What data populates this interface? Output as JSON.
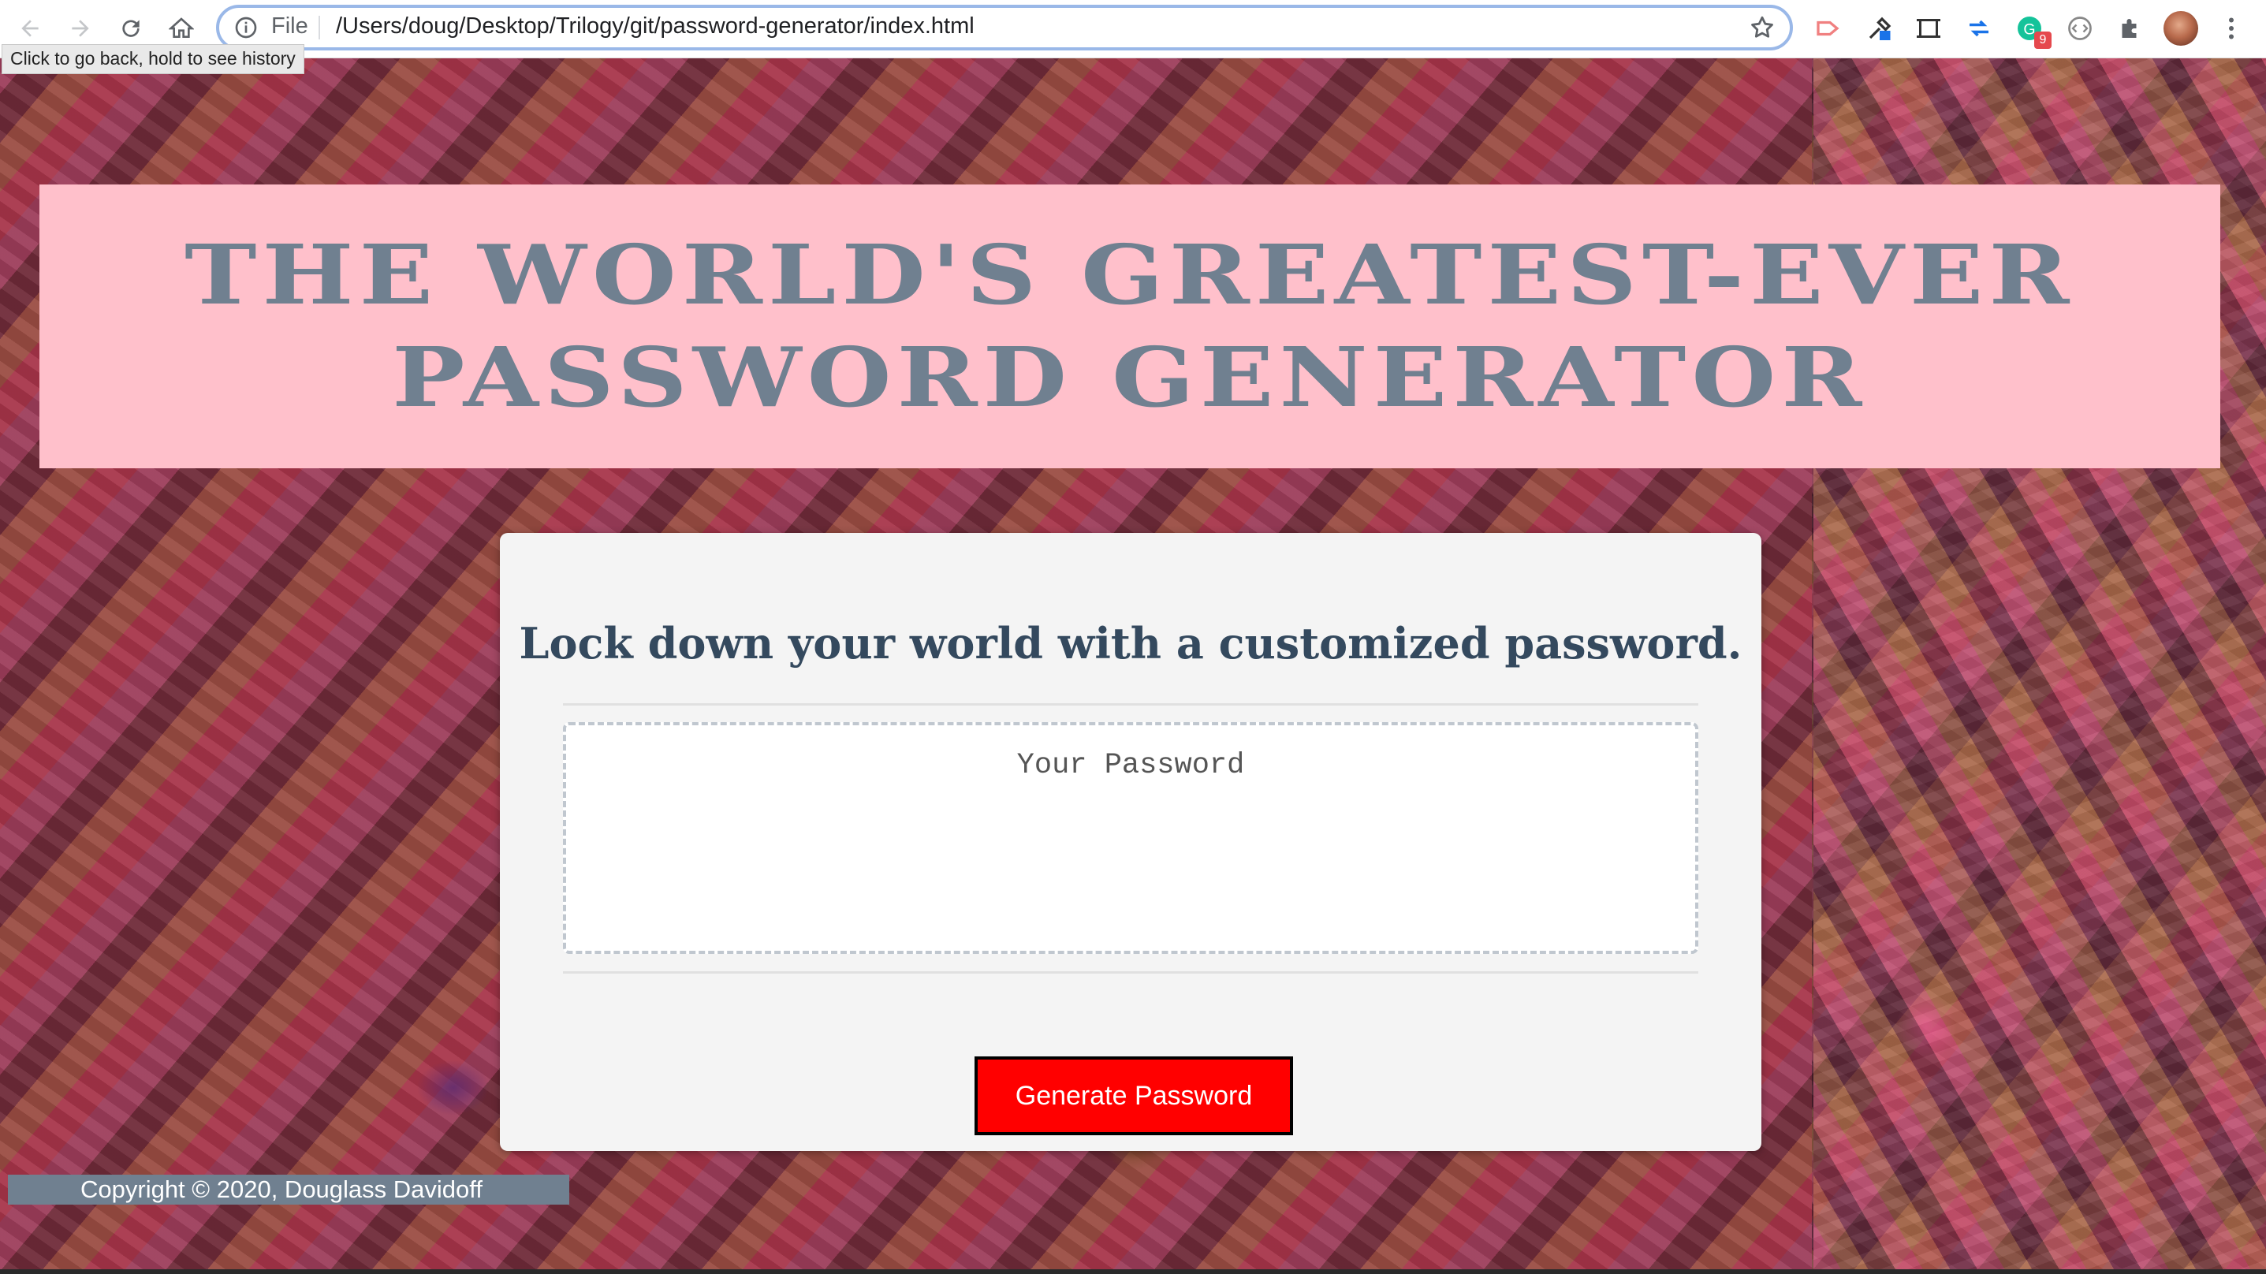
{
  "browser": {
    "omnibox_scheme": "File",
    "url": "/Users/doug/Desktop/Trilogy/git/password-generator/index.html",
    "tooltip": "Click to go back, hold to see history",
    "extension_badge": "9",
    "icons": [
      "back-icon",
      "forward-icon",
      "reload-icon",
      "home-icon",
      "info-icon",
      "star-icon",
      "cast-icon",
      "eyedropper-icon",
      "screenshot-icon",
      "sync-arrows-icon",
      "grammarly-icon",
      "code-icon",
      "puzzle-icon",
      "avatar",
      "kebab-menu-icon"
    ]
  },
  "page": {
    "header": {
      "title_line1": "THE WORLD'S GREATEST-EVER",
      "title_line2": "PASSWORD GENERATOR"
    },
    "card": {
      "heading": "Lock down your world with a customized password.",
      "password_placeholder": "Your Password",
      "password_value": "",
      "generate_label": "Generate Password"
    },
    "footer": {
      "copyright": "Copyright © 2020, Douglass Davidoff"
    }
  },
  "colors": {
    "header_bg": "#ffc0cb",
    "header_text": "#708090",
    "button_bg": "#ff0000",
    "card_bg": "#f4f4f4",
    "footer_bg": "#708090",
    "omnibox_border": "#9ab8e8"
  }
}
